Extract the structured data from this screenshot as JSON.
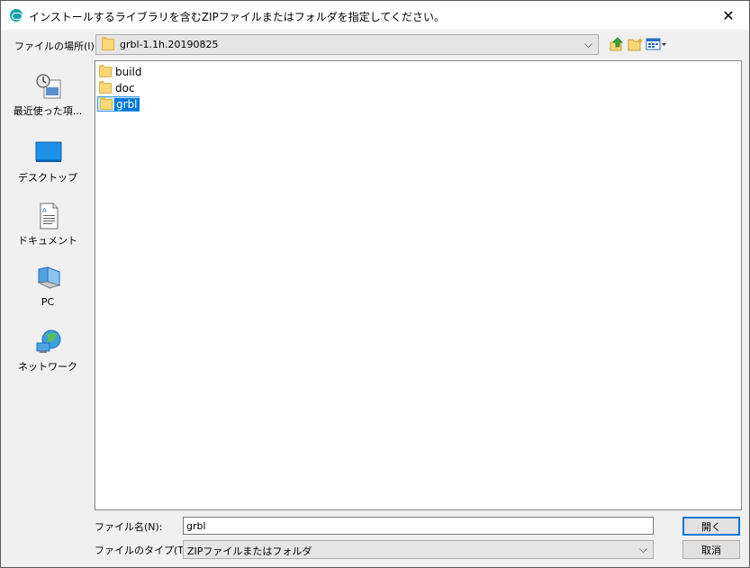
{
  "window": {
    "title": "インストールするライブラリを含むZIPファイルまたはフォルダを指定してください。",
    "close_label": "✕"
  },
  "lookin": {
    "label": "ファイルの場所(I):",
    "value": "grbl-1.1h.20190825"
  },
  "places": [
    {
      "label": "最近使った項..."
    },
    {
      "label": "デスクトップ"
    },
    {
      "label": "ドキュメント"
    },
    {
      "label": "PC"
    },
    {
      "label": "ネットワーク"
    }
  ],
  "files": [
    {
      "name": "build"
    },
    {
      "name": "doc"
    },
    {
      "name": "grbl"
    }
  ],
  "filename": {
    "label": "ファイル名(N):",
    "value": "grbl"
  },
  "filetype": {
    "label": "ファイルのタイプ(T):",
    "value": "ZIPファイルまたはフォルダ"
  },
  "buttons": {
    "open": "開く",
    "cancel": "取消"
  },
  "icons": {
    "app": "arduino-icon",
    "up": "up-folder-icon",
    "new_folder": "new-folder-icon",
    "view": "view-menu-icon"
  },
  "colors": {
    "selection": "#0078d7",
    "folder": "#f8d775"
  }
}
